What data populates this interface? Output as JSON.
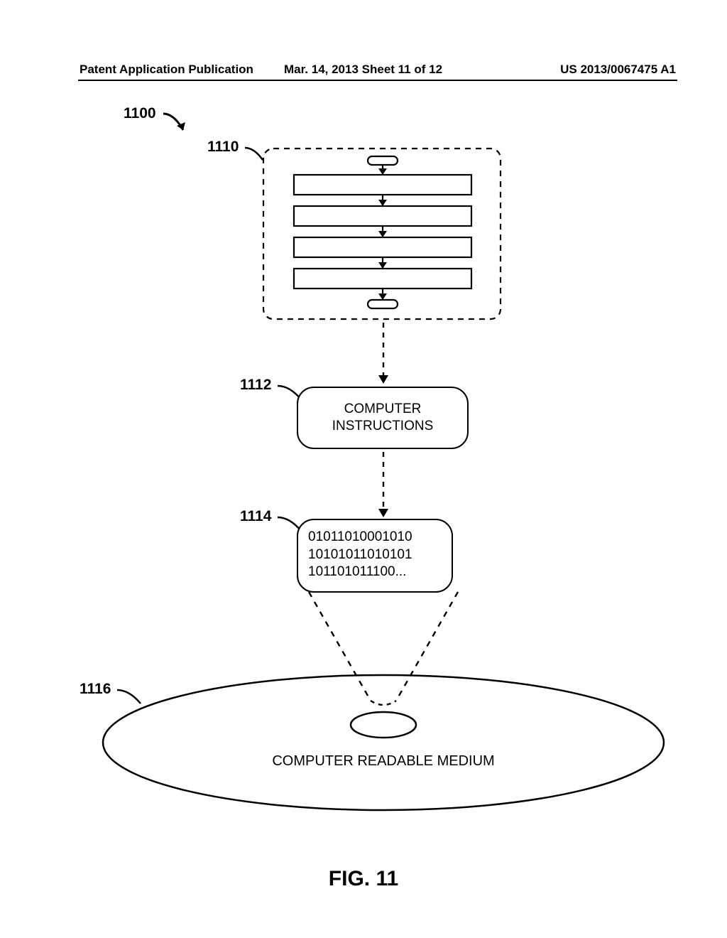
{
  "header": {
    "left": "Patent Application Publication",
    "center": "Mar. 14, 2013  Sheet 11 of 12",
    "right": "US 2013/0067475 A1"
  },
  "refs": {
    "r1100": "1100",
    "r1110": "1110",
    "r1112": "1112",
    "r1114": "1114",
    "r1116": "1116"
  },
  "boxes": {
    "computer_instructions_line1": "COMPUTER",
    "computer_instructions_line2": "INSTRUCTIONS",
    "binary_line1": "01011010001010",
    "binary_line2": "10101011010101",
    "binary_line3": "101101011100..."
  },
  "disc": {
    "label": "COMPUTER READABLE MEDIUM"
  },
  "figure": {
    "label": "FIG. 11"
  }
}
